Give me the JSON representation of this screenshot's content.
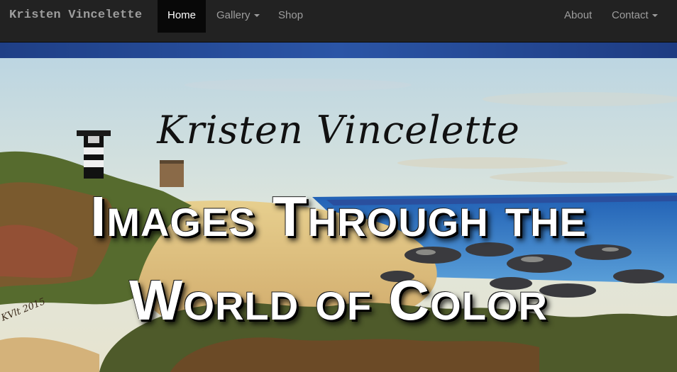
{
  "navbar": {
    "brand": "Kristen Vincelette",
    "left_items": [
      {
        "label": "Home",
        "active": true
      },
      {
        "label": "Gallery",
        "dropdown": true
      },
      {
        "label": "Shop"
      }
    ],
    "right_items": [
      {
        "label": "About"
      },
      {
        "label": "Contact",
        "dropdown": true
      }
    ]
  },
  "hero": {
    "script_title": "Kristen Vincelette",
    "headline_line1": "Images Through the",
    "headline_line2": "World of Color",
    "signature": "KVlt 2015"
  },
  "colors": {
    "navbar_bg": "#222222",
    "nav_text": "#9d9d9d",
    "nav_active_bg": "#080808",
    "nav_active_text": "#ffffff",
    "headline_text": "#ffffff"
  }
}
